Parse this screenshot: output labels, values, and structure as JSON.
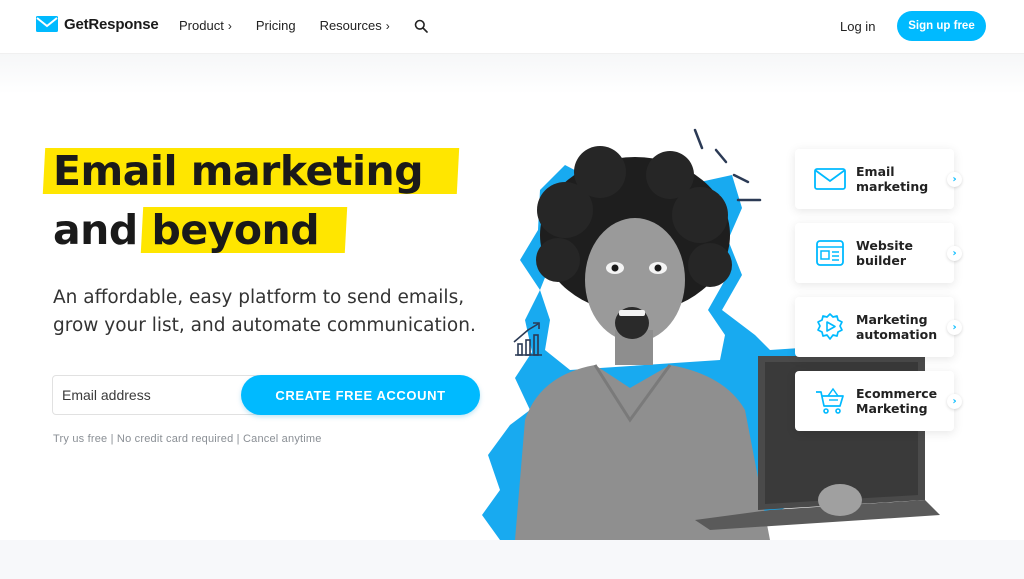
{
  "header": {
    "brand": "GetResponse",
    "nav": [
      {
        "label": "Product",
        "chevron": "›"
      },
      {
        "label": "Pricing",
        "chevron": ""
      },
      {
        "label": "Resources",
        "chevron": "›"
      }
    ],
    "search_icon": "search-icon",
    "login_label": "Log in",
    "signup_label": "Sign up free"
  },
  "hero": {
    "headline_line1": "Email marketing",
    "headline_line2_a": "and",
    "headline_line2_b": "beyond",
    "subtitle_line1": "An affordable, easy platform to send emails,",
    "subtitle_line2": "grow your list, and automate communication.",
    "email_placeholder": "Email address",
    "cta_label": "CREATE FREE ACCOUNT",
    "fine_print": "Try us free | No credit card required | Cancel anytime"
  },
  "features": [
    {
      "line1": "Email",
      "line2": "marketing",
      "icon": "envelope-icon"
    },
    {
      "line1": "Website",
      "line2": "builder",
      "icon": "website-icon"
    },
    {
      "line1": "Marketing",
      "line2": "automation",
      "icon": "gear-play-icon"
    },
    {
      "line1": "Ecommerce",
      "line2": "Marketing",
      "icon": "cart-icon"
    }
  ],
  "colors": {
    "accent": "#00baff",
    "highlight": "#ffe600",
    "text": "#1a1a1a"
  }
}
